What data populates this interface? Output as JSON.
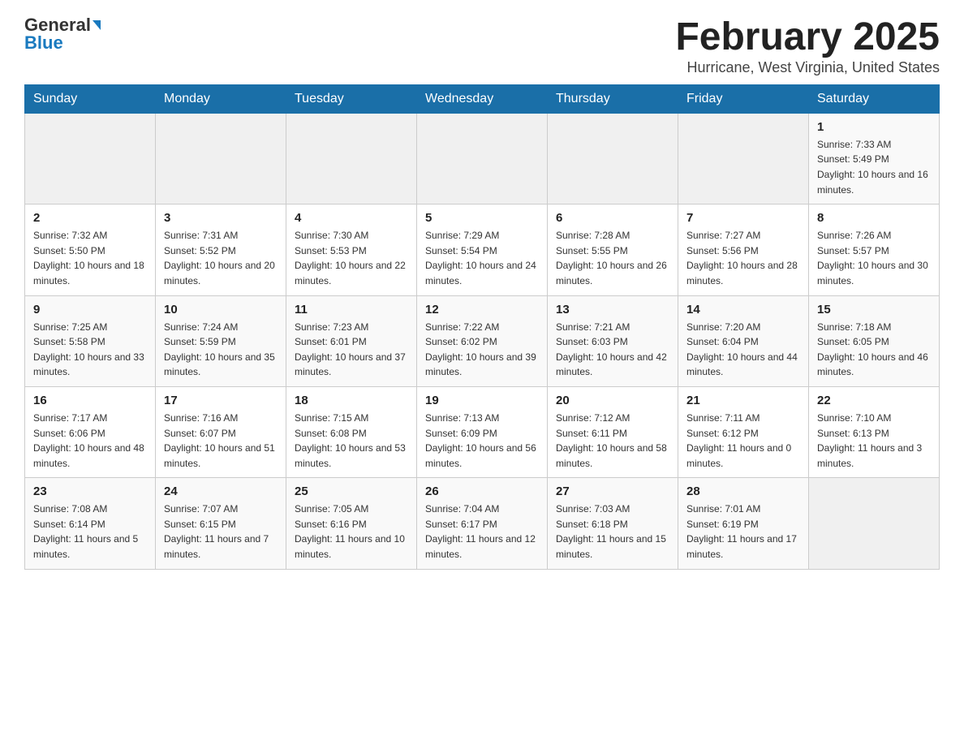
{
  "header": {
    "logo_general": "General",
    "logo_blue": "Blue",
    "title": "February 2025",
    "subtitle": "Hurricane, West Virginia, United States"
  },
  "days_of_week": [
    "Sunday",
    "Monday",
    "Tuesday",
    "Wednesday",
    "Thursday",
    "Friday",
    "Saturday"
  ],
  "weeks": [
    [
      {
        "day": "",
        "info": ""
      },
      {
        "day": "",
        "info": ""
      },
      {
        "day": "",
        "info": ""
      },
      {
        "day": "",
        "info": ""
      },
      {
        "day": "",
        "info": ""
      },
      {
        "day": "",
        "info": ""
      },
      {
        "day": "1",
        "info": "Sunrise: 7:33 AM\nSunset: 5:49 PM\nDaylight: 10 hours and 16 minutes."
      }
    ],
    [
      {
        "day": "2",
        "info": "Sunrise: 7:32 AM\nSunset: 5:50 PM\nDaylight: 10 hours and 18 minutes."
      },
      {
        "day": "3",
        "info": "Sunrise: 7:31 AM\nSunset: 5:52 PM\nDaylight: 10 hours and 20 minutes."
      },
      {
        "day": "4",
        "info": "Sunrise: 7:30 AM\nSunset: 5:53 PM\nDaylight: 10 hours and 22 minutes."
      },
      {
        "day": "5",
        "info": "Sunrise: 7:29 AM\nSunset: 5:54 PM\nDaylight: 10 hours and 24 minutes."
      },
      {
        "day": "6",
        "info": "Sunrise: 7:28 AM\nSunset: 5:55 PM\nDaylight: 10 hours and 26 minutes."
      },
      {
        "day": "7",
        "info": "Sunrise: 7:27 AM\nSunset: 5:56 PM\nDaylight: 10 hours and 28 minutes."
      },
      {
        "day": "8",
        "info": "Sunrise: 7:26 AM\nSunset: 5:57 PM\nDaylight: 10 hours and 30 minutes."
      }
    ],
    [
      {
        "day": "9",
        "info": "Sunrise: 7:25 AM\nSunset: 5:58 PM\nDaylight: 10 hours and 33 minutes."
      },
      {
        "day": "10",
        "info": "Sunrise: 7:24 AM\nSunset: 5:59 PM\nDaylight: 10 hours and 35 minutes."
      },
      {
        "day": "11",
        "info": "Sunrise: 7:23 AM\nSunset: 6:01 PM\nDaylight: 10 hours and 37 minutes."
      },
      {
        "day": "12",
        "info": "Sunrise: 7:22 AM\nSunset: 6:02 PM\nDaylight: 10 hours and 39 minutes."
      },
      {
        "day": "13",
        "info": "Sunrise: 7:21 AM\nSunset: 6:03 PM\nDaylight: 10 hours and 42 minutes."
      },
      {
        "day": "14",
        "info": "Sunrise: 7:20 AM\nSunset: 6:04 PM\nDaylight: 10 hours and 44 minutes."
      },
      {
        "day": "15",
        "info": "Sunrise: 7:18 AM\nSunset: 6:05 PM\nDaylight: 10 hours and 46 minutes."
      }
    ],
    [
      {
        "day": "16",
        "info": "Sunrise: 7:17 AM\nSunset: 6:06 PM\nDaylight: 10 hours and 48 minutes."
      },
      {
        "day": "17",
        "info": "Sunrise: 7:16 AM\nSunset: 6:07 PM\nDaylight: 10 hours and 51 minutes."
      },
      {
        "day": "18",
        "info": "Sunrise: 7:15 AM\nSunset: 6:08 PM\nDaylight: 10 hours and 53 minutes."
      },
      {
        "day": "19",
        "info": "Sunrise: 7:13 AM\nSunset: 6:09 PM\nDaylight: 10 hours and 56 minutes."
      },
      {
        "day": "20",
        "info": "Sunrise: 7:12 AM\nSunset: 6:11 PM\nDaylight: 10 hours and 58 minutes."
      },
      {
        "day": "21",
        "info": "Sunrise: 7:11 AM\nSunset: 6:12 PM\nDaylight: 11 hours and 0 minutes."
      },
      {
        "day": "22",
        "info": "Sunrise: 7:10 AM\nSunset: 6:13 PM\nDaylight: 11 hours and 3 minutes."
      }
    ],
    [
      {
        "day": "23",
        "info": "Sunrise: 7:08 AM\nSunset: 6:14 PM\nDaylight: 11 hours and 5 minutes."
      },
      {
        "day": "24",
        "info": "Sunrise: 7:07 AM\nSunset: 6:15 PM\nDaylight: 11 hours and 7 minutes."
      },
      {
        "day": "25",
        "info": "Sunrise: 7:05 AM\nSunset: 6:16 PM\nDaylight: 11 hours and 10 minutes."
      },
      {
        "day": "26",
        "info": "Sunrise: 7:04 AM\nSunset: 6:17 PM\nDaylight: 11 hours and 12 minutes."
      },
      {
        "day": "27",
        "info": "Sunrise: 7:03 AM\nSunset: 6:18 PM\nDaylight: 11 hours and 15 minutes."
      },
      {
        "day": "28",
        "info": "Sunrise: 7:01 AM\nSunset: 6:19 PM\nDaylight: 11 hours and 17 minutes."
      },
      {
        "day": "",
        "info": ""
      }
    ]
  ]
}
